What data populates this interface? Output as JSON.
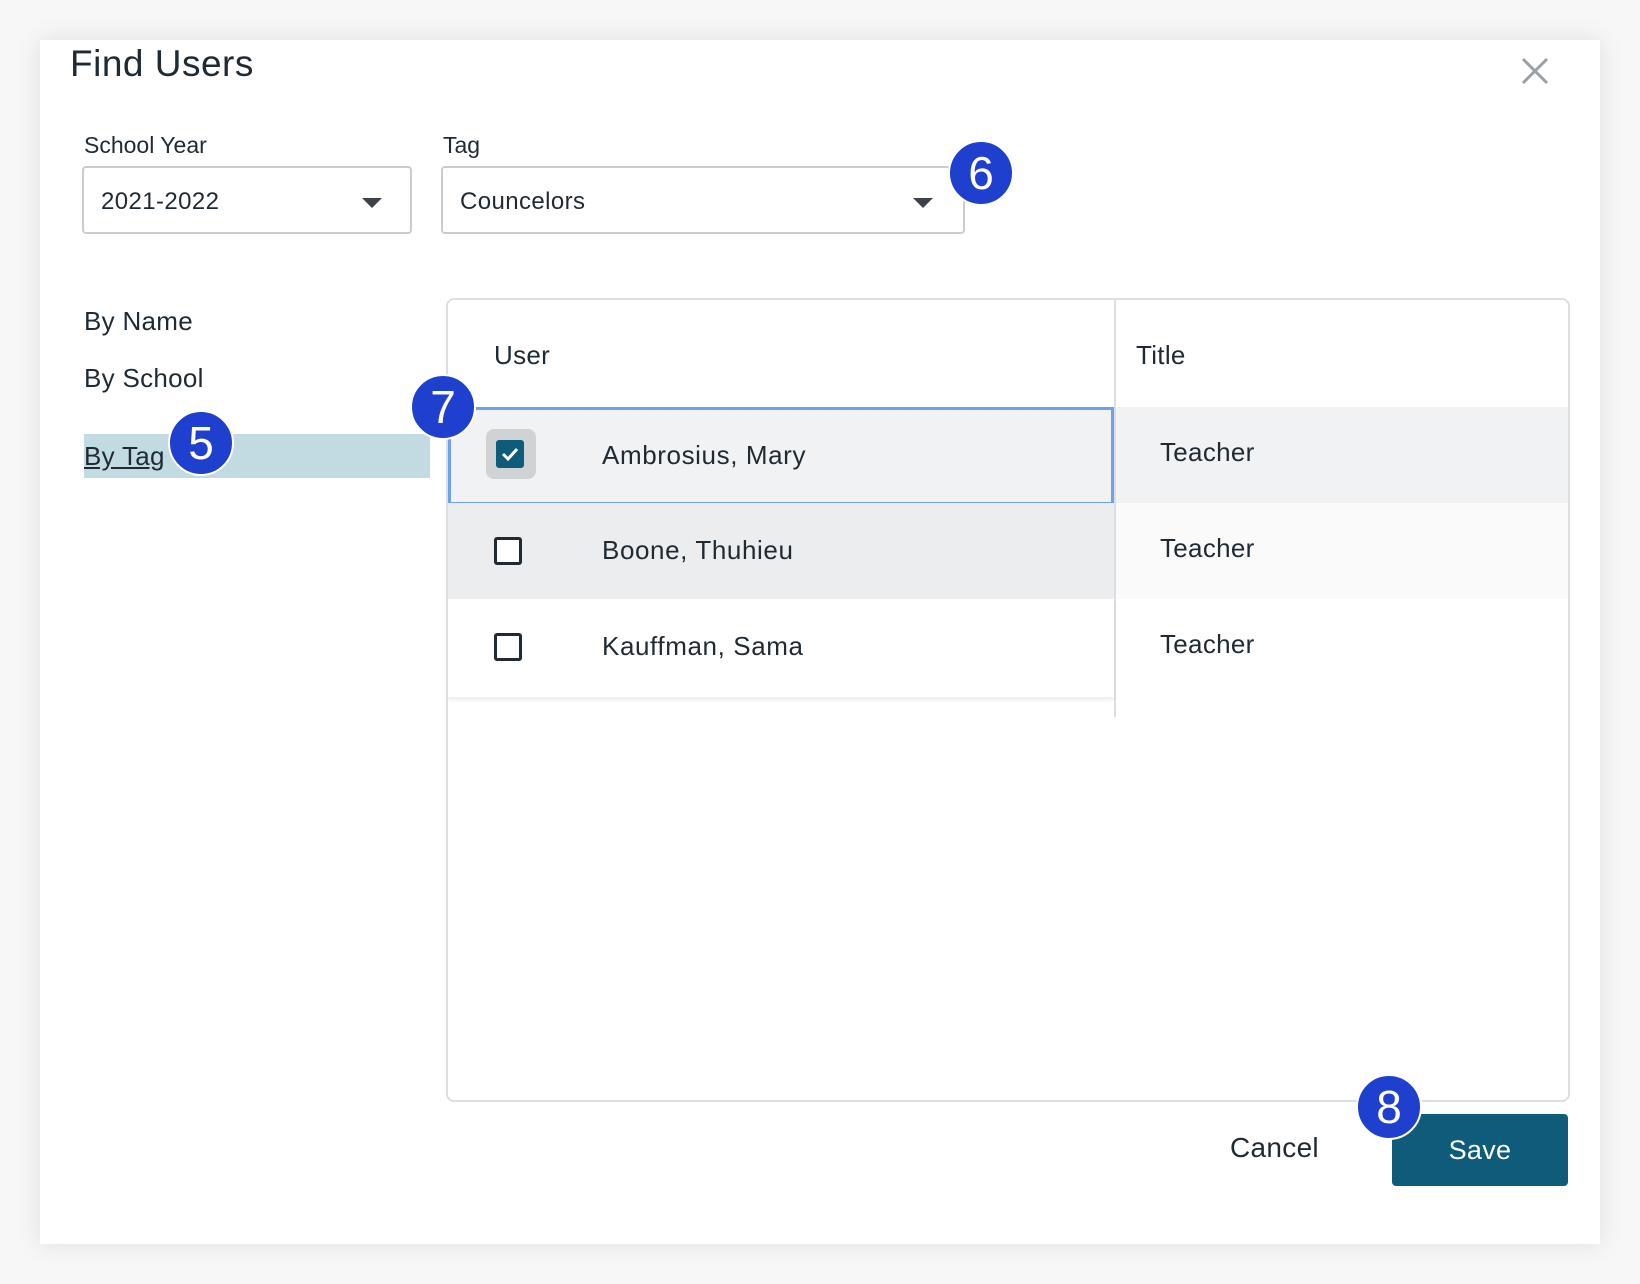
{
  "dialog": {
    "title": "Find Users",
    "close_icon": "close-icon"
  },
  "filters": {
    "school_year": {
      "label": "School Year",
      "value": "2021-2022"
    },
    "tag": {
      "label": "Tag",
      "value": "Councelors"
    }
  },
  "nav": {
    "items": [
      {
        "label": "By Name",
        "active": false
      },
      {
        "label": "By School",
        "active": false
      },
      {
        "label": "By Tag",
        "active": true
      }
    ]
  },
  "table": {
    "columns": [
      "User",
      "Title"
    ],
    "rows": [
      {
        "name": "Ambrosius, Mary",
        "title": "Teacher",
        "checked": true
      },
      {
        "name": "Boone, Thuhieu",
        "title": "Teacher",
        "checked": false
      },
      {
        "name": "Kauffman, Sama",
        "title": "Teacher",
        "checked": false
      }
    ]
  },
  "footer": {
    "cancel_label": "Cancel",
    "save_label": "Save"
  },
  "badges": [
    "5",
    "6",
    "7",
    "8"
  ],
  "colors": {
    "accent": "#0e5b7a",
    "badge": "#1f3fce",
    "active_nav": "#c2dbe3",
    "selected_row_outline": "#6ea0ee"
  }
}
